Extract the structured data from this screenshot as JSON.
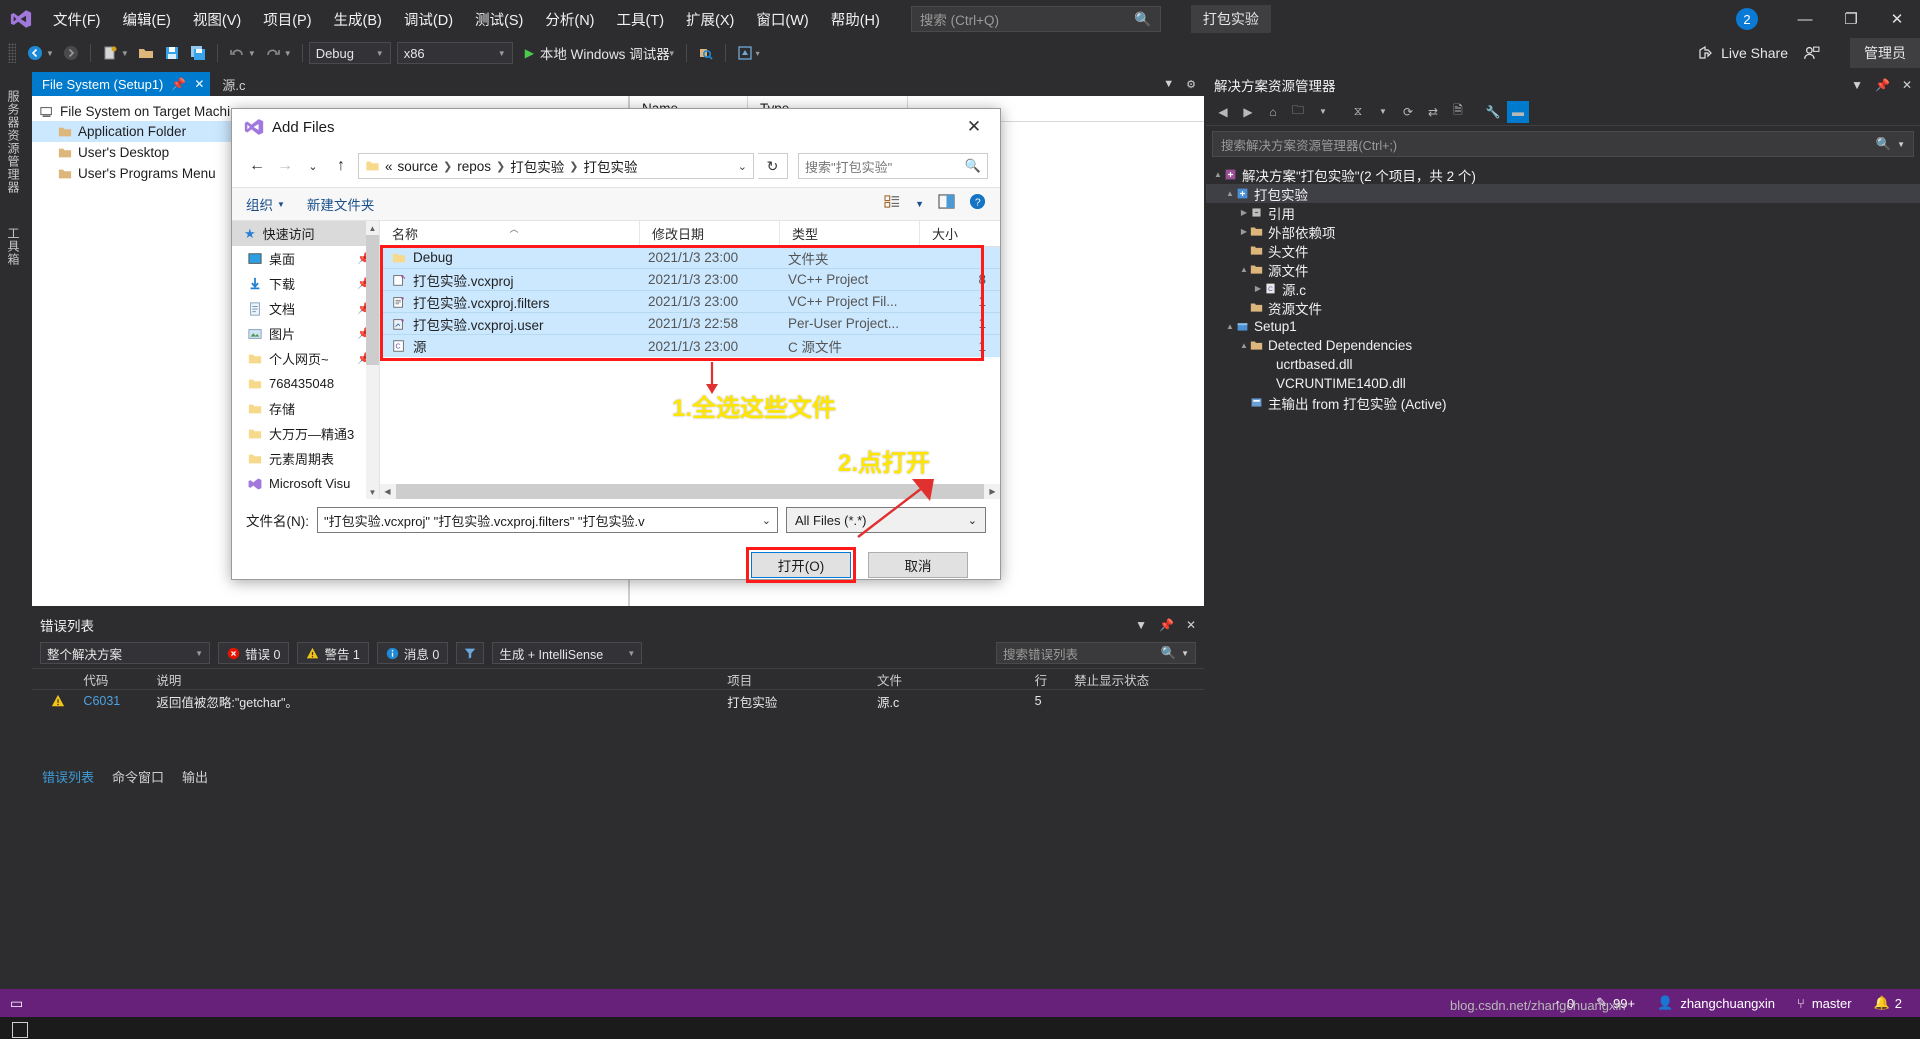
{
  "app": {
    "title_chip": "打包实验",
    "notification_badge": "2",
    "window_buttons": {
      "minimize": "—",
      "maximize": "❐",
      "close": "✕"
    },
    "logo_icon": "visual-studio-logo"
  },
  "menu": {
    "items": [
      "文件(F)",
      "编辑(E)",
      "视图(V)",
      "项目(P)",
      "生成(B)",
      "调试(D)",
      "测试(S)",
      "分析(N)",
      "工具(T)",
      "扩展(X)",
      "窗口(W)",
      "帮助(H)"
    ],
    "search_placeholder": "搜索 (Ctrl+Q)",
    "search_icon": "search-icon"
  },
  "toolbar": {
    "back_icon": "back-arrow-icon",
    "forward_icon": "forward-arrow-icon",
    "new_icon": "new-file-icon",
    "open_icon": "open-folder-icon",
    "save_icon": "save-icon",
    "save_all_icon": "save-all-icon",
    "undo_icon": "undo-icon",
    "redo_icon": "redo-icon",
    "config": "Debug",
    "platform": "x86",
    "run_label": "本地 Windows 调试器",
    "run_icon": "play-icon",
    "extra_icon_1": "find-icon",
    "extra_icon_2": "preview-icon",
    "live_share": "Live Share",
    "live_share_icon": "share-icon",
    "account_icon": "account-icon",
    "admin_label": "管理员"
  },
  "vertical_tabs": [
    {
      "label": "服务器资源管理器"
    },
    {
      "label": "工具箱"
    }
  ],
  "editor_tabs": {
    "active": {
      "label": "File System (Setup1)",
      "pin_icon": "pin-icon",
      "close_icon": "close-icon"
    },
    "inactive": {
      "label": "源.c"
    },
    "chevron_icon": "chevron-down-icon",
    "settings_icon": "gear-icon"
  },
  "designer": {
    "root": "File System on Target Machine",
    "root_icon": "computer-icon",
    "nodes": [
      {
        "label": "Application Folder",
        "icon": "folder-icon",
        "selected": true
      },
      {
        "label": "User's Desktop",
        "icon": "folder-icon",
        "selected": false
      },
      {
        "label": "User's Programs Menu",
        "icon": "folder-icon",
        "selected": false
      }
    ],
    "columns": [
      "Name",
      "Type"
    ]
  },
  "solution_explorer": {
    "title": "解决方案资源管理器",
    "pin_icon": "pin-icon",
    "close_icon": "close-icon",
    "chevron_icon": "chevron-down-icon",
    "search_placeholder": "搜索解决方案资源管理器(Ctrl+;)",
    "search_icon": "search-icon",
    "tools": [
      "back-icon",
      "forward-icon",
      "home-icon",
      "folder-view-icon",
      "filter-icon",
      "refresh-icon",
      "collapse-icon",
      "show-all-icon",
      "properties-icon",
      "preview-icon"
    ],
    "tree": [
      {
        "depth": 0,
        "twisty": "▲",
        "icon": "solution-icon",
        "label": "解决方案\"打包实验\"(2 个项目，共 2 个)"
      },
      {
        "depth": 1,
        "twisty": "▲",
        "icon": "project-icon",
        "label": "打包实验",
        "selected": true
      },
      {
        "depth": 2,
        "twisty": "▶",
        "icon": "references-icon",
        "label": "引用"
      },
      {
        "depth": 2,
        "twisty": "▶",
        "icon": "folder-icon",
        "label": "外部依赖项"
      },
      {
        "depth": 2,
        "twisty": "",
        "icon": "folder-icon",
        "label": "头文件"
      },
      {
        "depth": 2,
        "twisty": "▲",
        "icon": "folder-icon",
        "label": "源文件"
      },
      {
        "depth": 3,
        "twisty": "▶",
        "icon": "c-file-icon",
        "label": "源.c"
      },
      {
        "depth": 2,
        "twisty": "",
        "icon": "folder-icon",
        "label": "资源文件"
      },
      {
        "depth": 1,
        "twisty": "▲",
        "icon": "setup-icon",
        "label": "Setup1"
      },
      {
        "depth": 2,
        "twisty": "▲",
        "icon": "folder-icon",
        "label": "Detected Dependencies"
      },
      {
        "depth": 3,
        "twisty": "",
        "icon": "dll-icon",
        "label": "ucrtbased.dll"
      },
      {
        "depth": 3,
        "twisty": "",
        "icon": "dll-icon",
        "label": "VCRUNTIME140D.dll"
      },
      {
        "depth": 2,
        "twisty": "",
        "icon": "output-icon",
        "label": "主输出 from 打包实验 (Active)"
      }
    ]
  },
  "error_list": {
    "title": "错误列表",
    "pin_icon": "pin-icon",
    "close_icon": "close-icon",
    "chevron_icon": "chevron-down-icon",
    "scope": "整个解决方案",
    "errors_label": "错误 0",
    "warnings_label": "警告 1",
    "messages_label": "消息 0",
    "filter_icon": "filter-icon",
    "build_filter": "生成 + IntelliSense",
    "search_placeholder": "搜索错误列表",
    "search_icon": "search-icon",
    "columns": [
      "",
      "代码",
      "说明",
      "项目",
      "文件",
      "行",
      "禁止显示状态"
    ],
    "rows": [
      {
        "severity_icon": "warning-icon",
        "code": "C6031",
        "description": "返回值被忽略:\"getchar\"。",
        "project": "打包实验",
        "file": "源.c",
        "line": "5",
        "suppression": ""
      }
    ],
    "bottom_tabs": [
      "错误列表",
      "命令窗口",
      "输出"
    ],
    "bottom_active": "错误列表"
  },
  "status_bar": {
    "ready_icon": "ready-icon",
    "up_arrow_icon": "up-arrow-icon",
    "up_count": "0",
    "pencil_icon": "pencil-icon",
    "pencil_count": "99+",
    "user_icon": "user-icon",
    "user_name": "zhangchuangxin",
    "branch_icon": "branch-icon",
    "branch_name": "master",
    "bell_icon": "bell-icon",
    "bell_count": "2"
  },
  "dialog": {
    "title": "Add Files",
    "title_icon": "visual-studio-logo",
    "close_icon": "close-icon",
    "nav": {
      "back_icon": "back-arrow-icon",
      "forward_icon": "forward-arrow-icon",
      "history_icon": "chevron-down-icon",
      "up_icon": "up-arrow-icon",
      "folder_icon": "folder-icon",
      "breadcrumb": [
        "«",
        "source",
        "repos",
        "打包实验",
        "打包实验"
      ],
      "dropdown_icon": "chevron-down-icon",
      "refresh_icon": "refresh-icon",
      "search_placeholder": "搜索\"打包实验\"",
      "search_icon": "search-icon"
    },
    "commandbar": {
      "organize": "组织",
      "organize_caret": "▼",
      "new_folder": "新建文件夹",
      "view_icon": "list-view-icon",
      "view_caret": "▼",
      "pane_icon": "preview-pane-icon",
      "help_icon": "help-icon"
    },
    "sidebar": [
      {
        "label": "快速访问",
        "icon": "star-icon",
        "pinned": false,
        "header": true
      },
      {
        "label": "桌面",
        "icon": "desktop-icon",
        "pinned": true
      },
      {
        "label": "下载",
        "icon": "download-icon",
        "pinned": true
      },
      {
        "label": "文档",
        "icon": "documents-icon",
        "pinned": true
      },
      {
        "label": "图片",
        "icon": "pictures-icon",
        "pinned": true
      },
      {
        "label": "个人网页~",
        "icon": "folder-icon",
        "pinned": true
      },
      {
        "label": "768435048",
        "icon": "folder-icon",
        "pinned": false
      },
      {
        "label": "存储",
        "icon": "folder-icon",
        "pinned": false
      },
      {
        "label": "大万万—精通3",
        "icon": "folder-icon",
        "pinned": false
      },
      {
        "label": "元素周期表",
        "icon": "folder-icon",
        "pinned": false
      },
      {
        "label": "Microsoft Visu",
        "icon": "vs-icon",
        "pinned": false
      }
    ],
    "columns": [
      "名称",
      "修改日期",
      "类型",
      "大小"
    ],
    "files": [
      {
        "name": "Debug",
        "icon": "folder-icon",
        "date": "2021/1/3 23:00",
        "type": "文件夹",
        "size": ""
      },
      {
        "name": "打包实验.vcxproj",
        "icon": "vcxproj-icon",
        "date": "2021/1/3 23:00",
        "type": "VC++ Project",
        "size": "8"
      },
      {
        "name": "打包实验.vcxproj.filters",
        "icon": "vcxfilters-icon",
        "date": "2021/1/3 23:00",
        "type": "VC++ Project Fil...",
        "size": "1"
      },
      {
        "name": "打包实验.vcxproj.user",
        "icon": "vcxuser-icon",
        "date": "2021/1/3 22:58",
        "type": "Per-User Project...",
        "size": "1"
      },
      {
        "name": "源",
        "icon": "c-file-icon",
        "date": "2021/1/3 23:00",
        "type": "C 源文件",
        "size": "1"
      }
    ],
    "footer": {
      "filename_label": "文件名(N):",
      "filename_value": "\"打包实验.vcxproj\" \"打包实验.vcxproj.filters\" \"打包实验.v",
      "filename_caret": "⌄",
      "filter_value": "All Files (*.*)",
      "filter_caret": "⌄",
      "open_button": "打开(O)",
      "cancel_button": "取消"
    }
  },
  "annotations": [
    {
      "text": "1.全选这些文件",
      "color": "#ffe600"
    },
    {
      "text": "2.点打开",
      "color": "#ffe600"
    }
  ],
  "watermark": "blog.csdn.net/zhangchuangxin"
}
